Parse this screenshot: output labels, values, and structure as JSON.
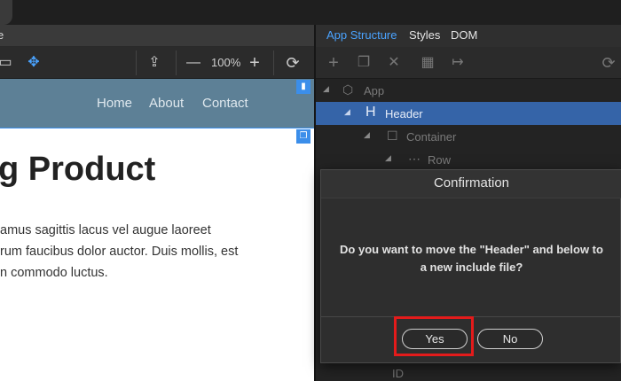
{
  "left": {
    "title_fragment": "e",
    "zoom_level": "100%",
    "nav": [
      "Home",
      "About",
      "Contact"
    ],
    "hero_title": "g Product",
    "hero_lines": [
      "amus sagittis lacus vel augue laoreet",
      "rum faucibus dolor auctor. Duis mollis, est",
      "n commodo luctus."
    ]
  },
  "right": {
    "tabs": [
      "App Structure",
      "Styles",
      "DOM"
    ],
    "active_tab": "App Structure",
    "tree": [
      {
        "label": "App",
        "icon": "cube-icon"
      },
      {
        "label": "Header",
        "icon": "header-icon",
        "selected": true
      },
      {
        "label": "Container",
        "icon": "container-icon"
      },
      {
        "label": "Row",
        "icon": "row-icon"
      }
    ],
    "id_label": "ID"
  },
  "dialog": {
    "title": "Confirmation",
    "message_line1": "Do you want to move the \"Header\" and below to",
    "message_line2": "a new include file?",
    "yes": "Yes",
    "no": "No"
  },
  "colors": {
    "accent": "#3b8eea",
    "header_bg": "#5d8096",
    "selection": "#3564a8",
    "highlight": "#e31b1b"
  }
}
